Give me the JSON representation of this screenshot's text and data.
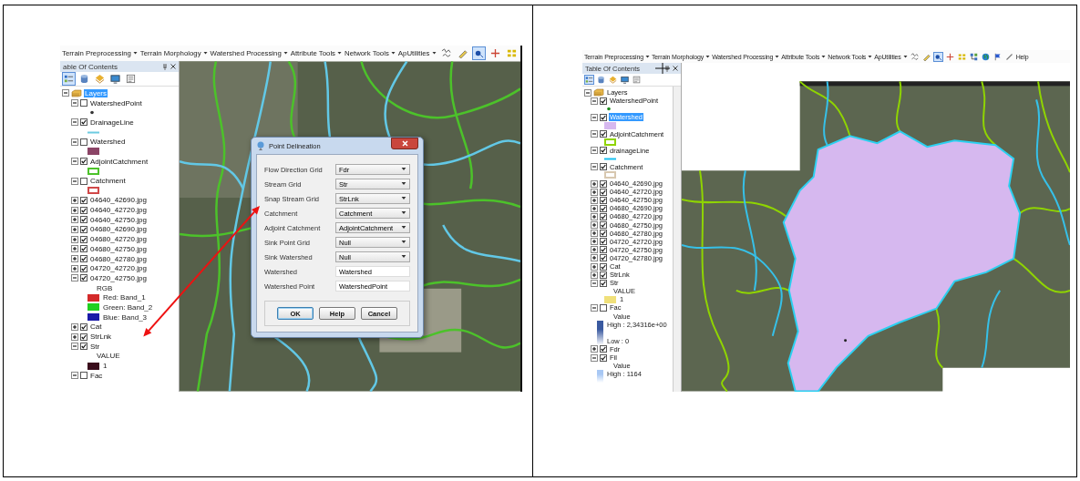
{
  "screenshots": [
    {
      "toolbar": {
        "menus": [
          {
            "label": "Terrain Preprocessing",
            "dropdown": true
          },
          {
            "label": "Terrain Morphology",
            "dropdown": true
          },
          {
            "label": "Watershed Processing",
            "dropdown": true
          },
          {
            "label": "Attribute Tools",
            "dropdown": true
          },
          {
            "label": "Network Tools",
            "dropdown": true
          },
          {
            "label": "ApUtilities",
            "dropdown": true
          }
        ],
        "tools": [
          {
            "kind": "squiggle",
            "selected": false
          },
          {
            "kind": "pencil",
            "selected": false
          },
          {
            "kind": "point",
            "selected": true
          },
          {
            "kind": "crosshair",
            "selected": false
          },
          {
            "kind": "grid",
            "selected": false
          }
        ]
      },
      "toc": {
        "title": "able Of Contents",
        "scrollable": false,
        "tools": [
          {
            "kind": "list",
            "selected": true
          },
          {
            "kind": "database",
            "selected": false
          },
          {
            "kind": "diamond",
            "selected": false
          },
          {
            "kind": "monitor",
            "selected": false
          },
          {
            "kind": "options",
            "selected": false
          }
        ],
        "layers": {
          "kind": "group",
          "name": "Layers",
          "expanded": true,
          "selected": true,
          "children": [
            {
              "kind": "layer",
              "name": "WatershedPoint",
              "checked": false,
              "expanded": true,
              "selected": false,
              "legend": [
                {
                  "kind": "point",
                  "color": "#333333"
                }
              ]
            },
            {
              "kind": "layer",
              "name": "DrainageLine",
              "checked": true,
              "expanded": true,
              "selected": false,
              "legend": [
                {
                  "kind": "line",
                  "color": "#6ccbe0"
                }
              ]
            },
            {
              "kind": "layer",
              "name": "Watershed",
              "checked": false,
              "expanded": true,
              "selected": false,
              "legend": [
                {
                  "kind": "fill",
                  "color": "#8b4466"
                }
              ]
            },
            {
              "kind": "layer",
              "name": "AdjointCatchment",
              "checked": true,
              "expanded": true,
              "selected": false,
              "legend": [
                {
                  "kind": "outline",
                  "color": "#4cc22a"
                }
              ]
            },
            {
              "kind": "layer",
              "name": "Catchment",
              "checked": false,
              "expanded": true,
              "selected": false,
              "legend": [
                {
                  "kind": "outline",
                  "color": "#d04848"
                }
              ]
            },
            {
              "kind": "layer",
              "name": "04640_42690.jpg",
              "checked": true,
              "expanded": false,
              "selected": false
            },
            {
              "kind": "layer",
              "name": "04640_42720.jpg",
              "checked": true,
              "expanded": false,
              "selected": false
            },
            {
              "kind": "layer",
              "name": "04640_42750.jpg",
              "checked": true,
              "expanded": false,
              "selected": false
            },
            {
              "kind": "layer",
              "name": "04680_42690.jpg",
              "checked": true,
              "expanded": false,
              "selected": false
            },
            {
              "kind": "layer",
              "name": "04680_42720.jpg",
              "checked": true,
              "expanded": false,
              "selected": false
            },
            {
              "kind": "layer",
              "name": "04680_42750.jpg",
              "checked": true,
              "expanded": false,
              "selected": false
            },
            {
              "kind": "layer",
              "name": "04680_42780.jpg",
              "checked": true,
              "expanded": false,
              "selected": false
            },
            {
              "kind": "layer",
              "name": "04720_42720.jpg",
              "checked": true,
              "expanded": false,
              "selected": false
            },
            {
              "kind": "layer",
              "name": "04720_42750.jpg",
              "checked": true,
              "expanded": true,
              "selected": false,
              "legend": [
                {
                  "kind": "heading",
                  "label": "RGB"
                },
                {
                  "kind": "swatch",
                  "color": "#d42a2a",
                  "label": "Red:  Band_1"
                },
                {
                  "kind": "swatch",
                  "color": "#20d020",
                  "label": "Green: Band_2"
                },
                {
                  "kind": "swatch",
                  "color": "#1a1aa8",
                  "label": "Blue:  Band_3"
                }
              ]
            },
            {
              "kind": "layer",
              "name": "Cat",
              "checked": true,
              "expanded": false,
              "selected": false
            },
            {
              "kind": "layer",
              "name": "StrLnk",
              "checked": true,
              "expanded": false,
              "selected": false
            },
            {
              "kind": "layer",
              "name": "Str",
              "checked": true,
              "expanded": true,
              "selected": false,
              "legend": [
                {
                  "kind": "heading",
                  "label": "VALUE"
                },
                {
                  "kind": "swatch",
                  "color": "#3a0c1c",
                  "label": "1"
                }
              ]
            },
            {
              "kind": "layer",
              "name": "Fac",
              "checked": false,
              "expanded": true,
              "selected": false
            }
          ]
        }
      },
      "map": {
        "kind": "streams"
      },
      "arrow": true,
      "dialog": {
        "title": "Point Delineation",
        "rows": [
          {
            "kind": "dropdown",
            "label": "Flow Direction Grid",
            "value": "Fdr"
          },
          {
            "kind": "dropdown",
            "label": "Stream Grid",
            "value": "Str"
          },
          {
            "kind": "dropdown",
            "label": "Snap Stream Grid",
            "value": "StrLnk"
          },
          {
            "kind": "dropdown",
            "label": "Catchment",
            "value": "Catchment"
          },
          {
            "kind": "dropdown",
            "label": "Adjoint Catchment",
            "value": "AdjointCatchment"
          },
          {
            "kind": "dropdown",
            "label": "Sink Point Grid",
            "value": "Null"
          },
          {
            "kind": "dropdown",
            "label": "Sink Watershed",
            "value": "Null"
          },
          {
            "kind": "text",
            "label": "Watershed",
            "value": "Watershed"
          },
          {
            "kind": "text",
            "label": "Watershed Point",
            "value": "WatershedPoint"
          }
        ],
        "buttons": [
          {
            "label": "OK",
            "default": true
          },
          {
            "label": "Help",
            "default": false
          },
          {
            "label": "Cancel",
            "default": false
          }
        ]
      }
    },
    {
      "toolbar": {
        "menus": [
          {
            "label": "Terrain Preprocessing",
            "dropdown": true
          },
          {
            "label": "Terrain Morphology",
            "dropdown": true
          },
          {
            "label": "Watershed Processing",
            "dropdown": true
          },
          {
            "label": "Attribute Tools",
            "dropdown": true
          },
          {
            "label": "Network Tools",
            "dropdown": true
          },
          {
            "label": "ApUtilities",
            "dropdown": true
          }
        ],
        "tools": [
          {
            "kind": "squiggle",
            "selected": false
          },
          {
            "kind": "pencil",
            "selected": false
          },
          {
            "kind": "point",
            "selected": true
          },
          {
            "kind": "crosshair",
            "selected": false
          },
          {
            "kind": "grid",
            "selected": false
          },
          {
            "kind": "network",
            "selected": false
          },
          {
            "kind": "globe",
            "selected": false
          },
          {
            "kind": "flag",
            "selected": false
          },
          {
            "kind": "line",
            "selected": false
          }
        ],
        "help": "Help"
      },
      "toc": {
        "title": "Table Of Contents",
        "scrollable": true,
        "tools": [
          {
            "kind": "list",
            "selected": true
          },
          {
            "kind": "database",
            "selected": false
          },
          {
            "kind": "diamond",
            "selected": false
          },
          {
            "kind": "monitor",
            "selected": false
          },
          {
            "kind": "options",
            "selected": false
          }
        ],
        "layers": {
          "kind": "group",
          "name": "Layers",
          "expanded": true,
          "selected": false,
          "children": [
            {
              "kind": "layer",
              "name": "WatershedPoint",
              "checked": true,
              "expanded": true,
              "selected": false,
              "legend": [
                {
                  "kind": "point",
                  "color": "#1e8c1e"
                }
              ]
            },
            {
              "kind": "layer",
              "name": "Watershed",
              "checked": true,
              "expanded": true,
              "selected": true,
              "legend": [
                {
                  "kind": "fill",
                  "color": "#d6b8ef"
                }
              ]
            },
            {
              "kind": "layer",
              "name": "AdjointCatchment",
              "checked": true,
              "expanded": true,
              "selected": false,
              "legend": [
                {
                  "kind": "outline",
                  "color": "#8fd400"
                }
              ]
            },
            {
              "kind": "layer",
              "name": "drainageLine",
              "checked": true,
              "expanded": true,
              "selected": false,
              "legend": [
                {
                  "kind": "line",
                  "color": "#18c0f0"
                }
              ]
            },
            {
              "kind": "layer",
              "name": "Catchment",
              "checked": true,
              "expanded": true,
              "selected": false,
              "legend": [
                {
                  "kind": "outline",
                  "color": "#d8c8b0"
                }
              ]
            },
            {
              "kind": "layer",
              "name": "04640_42690.jpg",
              "checked": true,
              "expanded": false,
              "selected": false
            },
            {
              "kind": "layer",
              "name": "04640_42720.jpg",
              "checked": true,
              "expanded": false,
              "selected": false
            },
            {
              "kind": "layer",
              "name": "04640_42750.jpg",
              "checked": true,
              "expanded": false,
              "selected": false
            },
            {
              "kind": "layer",
              "name": "04680_42690.jpg",
              "checked": true,
              "expanded": false,
              "selected": false
            },
            {
              "kind": "layer",
              "name": "04680_42720.jpg",
              "checked": true,
              "expanded": false,
              "selected": false
            },
            {
              "kind": "layer",
              "name": "04680_42750.jpg",
              "checked": true,
              "expanded": false,
              "selected": false
            },
            {
              "kind": "layer",
              "name": "04680_42780.jpg",
              "checked": true,
              "expanded": false,
              "selected": false
            },
            {
              "kind": "layer",
              "name": "04720_42720.jpg",
              "checked": true,
              "expanded": false,
              "selected": false
            },
            {
              "kind": "layer",
              "name": "04720_42750.jpg",
              "checked": true,
              "expanded": false,
              "selected": false
            },
            {
              "kind": "layer",
              "name": "04720_42780.jpg",
              "checked": true,
              "expanded": false,
              "selected": false
            },
            {
              "kind": "layer",
              "name": "Cat",
              "checked": true,
              "expanded": false,
              "selected": false
            },
            {
              "kind": "layer",
              "name": "StrLnk",
              "checked": true,
              "expanded": false,
              "selected": false
            },
            {
              "kind": "layer",
              "name": "Str",
              "checked": true,
              "expanded": true,
              "selected": false,
              "legend": [
                {
                  "kind": "heading",
                  "label": "VALUE"
                },
                {
                  "kind": "swatch",
                  "color": "#f0e07a",
                  "label": "1"
                }
              ]
            },
            {
              "kind": "layer",
              "name": "Fac",
              "checked": false,
              "expanded": true,
              "selected": false,
              "legend": [
                {
                  "kind": "heading",
                  "label": "Value"
                },
                {
                  "kind": "ramp",
                  "color": "#3a5aa0",
                  "high": "High : 2,34316e+00",
                  "low": "Low : 0"
                }
              ]
            },
            {
              "kind": "layer",
              "name": "Fdr",
              "checked": true,
              "expanded": false,
              "selected": false
            },
            {
              "kind": "layer",
              "name": "Fil",
              "checked": true,
              "expanded": true,
              "selected": false,
              "legend": [
                {
                  "kind": "heading",
                  "label": "Value"
                },
                {
                  "kind": "ramp",
                  "color": "#a8c8f4",
                  "high": "High : 1164"
                }
              ]
            }
          ]
        }
      },
      "map": {
        "kind": "watershed"
      },
      "crosshair_cursor": true
    }
  ]
}
